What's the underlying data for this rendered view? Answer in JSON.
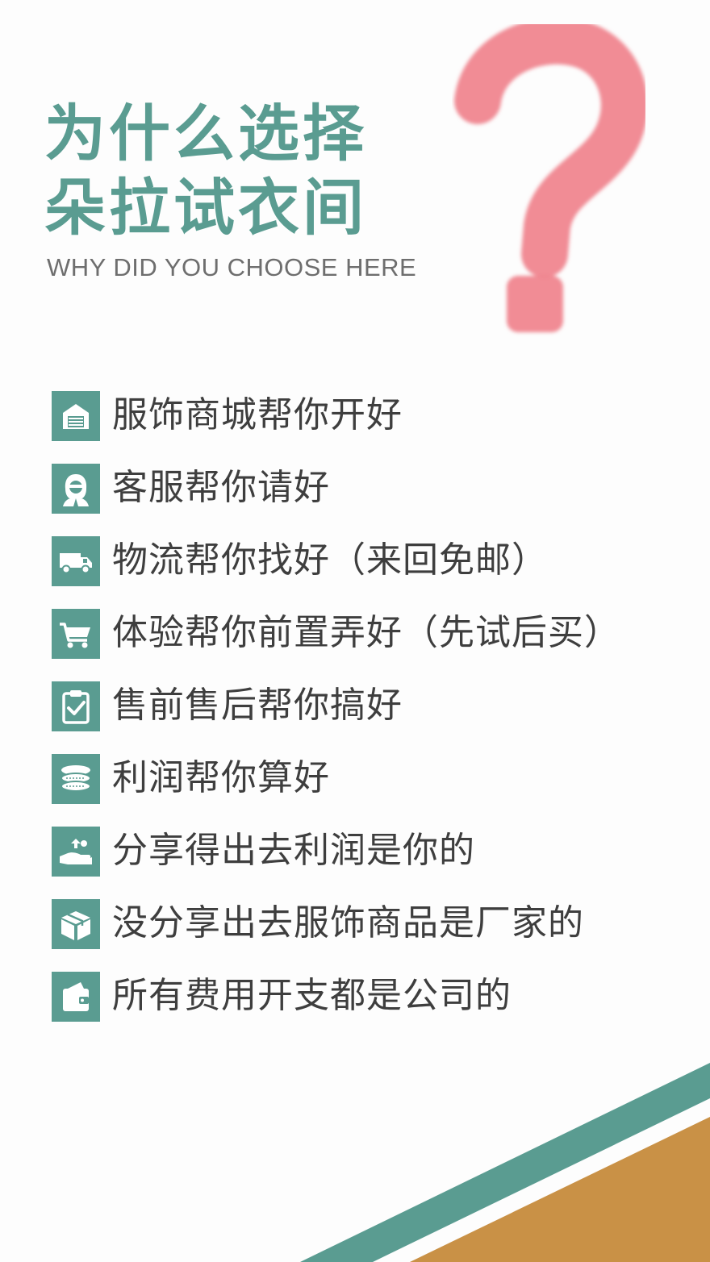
{
  "header": {
    "title_line1": "为什么选择",
    "title_line2": "朵拉试衣间",
    "subtitle": "WHY DID YOU CHOOSE HERE"
  },
  "colors": {
    "accent": "#5a9c91",
    "question_mark": "#f0808a",
    "stripe_teal": "#5a9c91",
    "stripe_orange": "#c99146",
    "text": "#3e3e3e"
  },
  "features": [
    {
      "icon": "store-icon",
      "text": "服饰商城帮你开好"
    },
    {
      "icon": "customer-service-icon",
      "text": "客服帮你请好"
    },
    {
      "icon": "delivery-truck-icon",
      "text": "物流帮你找好（来回免邮）"
    },
    {
      "icon": "shopping-cart-icon",
      "text": "体验帮你前置弄好（先试后买）"
    },
    {
      "icon": "clipboard-check-icon",
      "text": "售前售后帮你搞好"
    },
    {
      "icon": "coins-icon",
      "text": "利润帮你算好"
    },
    {
      "icon": "hand-money-icon",
      "text": "分享得出去利润是你的"
    },
    {
      "icon": "package-box-icon",
      "text": "没分享出去服饰商品是厂家的"
    },
    {
      "icon": "wallet-icon",
      "text": "所有费用开支都是公司的"
    }
  ]
}
